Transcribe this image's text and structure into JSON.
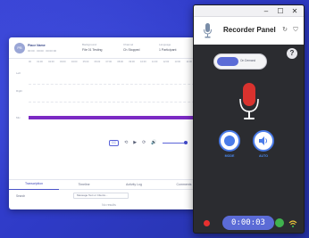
{
  "background_window": {
    "avatar_initials": "PB",
    "user_name": "Place Name",
    "user_sub": "00:00 · 00:00 · 00:00:00",
    "fields": [
      {
        "label": "Background",
        "value": "File 01 Testing"
      },
      {
        "label": "Channel",
        "value": "Ch Stopped"
      },
      {
        "label": "Language",
        "value": "1 Participant"
      }
    ],
    "ruler_ticks": [
      "00",
      "01:00",
      "02:00",
      "03:00",
      "04:00",
      "05:00",
      "06:00",
      "07:00",
      "08:00",
      "09:00",
      "10:00",
      "11:00",
      "12:00",
      "13:00",
      "14:00",
      "15:00"
    ],
    "tracks": [
      "Left",
      "Right",
      "Mix"
    ],
    "controls": {
      "cc": "CC",
      "skip_back": "⟲",
      "play": "▶",
      "skip_fwd": "⟳",
      "volume": "🔊"
    },
    "tabs": [
      "Transcription",
      "Timeline",
      "Activity Log",
      "Comments"
    ],
    "search_label": "Search",
    "filter_placeholder": "Message Text or Clients...",
    "empty_text": "No results"
  },
  "recorder": {
    "title": "Recorder Panel",
    "window_controls": {
      "minimize": "–",
      "maximize": "☐",
      "close": "✕"
    },
    "refresh_icon": "↻",
    "shield_icon": "⛉",
    "help_label": "?",
    "toggle_text": "On Demand",
    "buttons": [
      {
        "label": "MODE"
      },
      {
        "label": "AUTO"
      }
    ],
    "timer": "0:00:03",
    "colors": {
      "accent": "#5b6bd6",
      "record": "#e8302f",
      "mic": "#d9322e",
      "ok": "#3fb24e",
      "button_blue": "#4a7be8"
    }
  }
}
